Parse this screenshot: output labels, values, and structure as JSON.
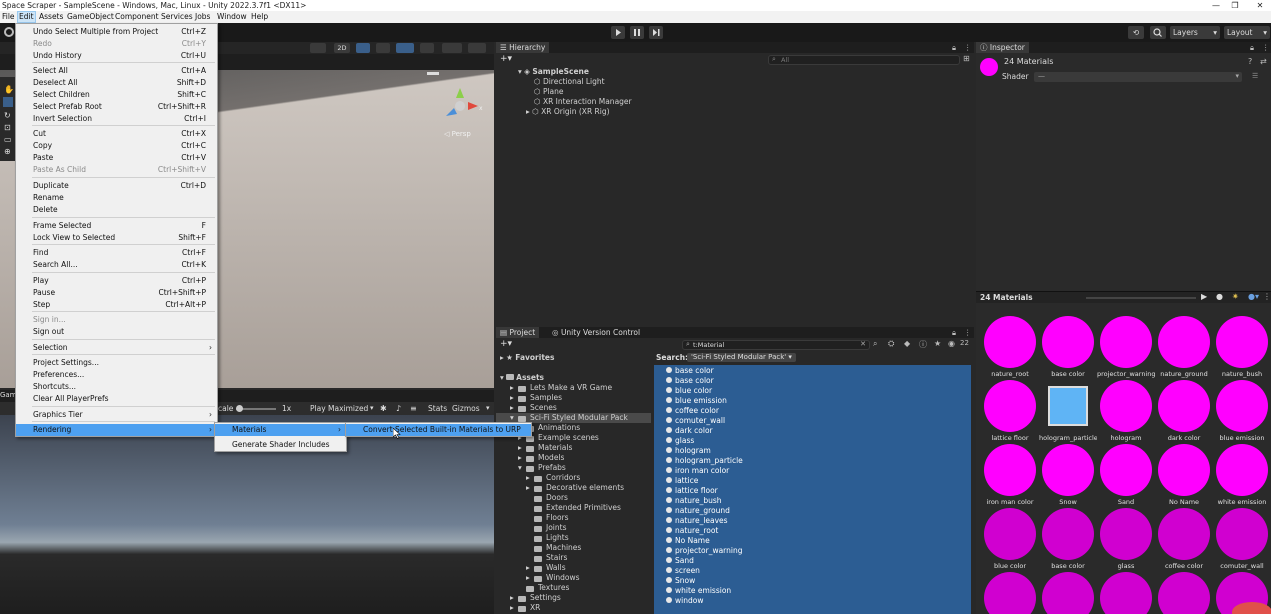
{
  "window": {
    "title": "Space Scraper - SampleScene - Windows, Mac, Linux - Unity 2022.3.7f1 <DX11>",
    "controls": [
      "—",
      "❐",
      "✕"
    ]
  },
  "menubar": {
    "items": [
      "File",
      "Edit",
      "Assets",
      "GameObject",
      "Component",
      "Services",
      "Jobs",
      "Window",
      "Help"
    ]
  },
  "toolbar": {
    "layers": "Layers",
    "layout": "Layout"
  },
  "scene": {
    "mode_2d": "2D",
    "persp": "◁ Persp"
  },
  "game": {
    "scale_label": "cale",
    "scale_value": "1x",
    "play_mode": "Play Maximized",
    "stats": "Stats",
    "gizmos": "Gizmos",
    "tab": "Gam"
  },
  "edit_menu": {
    "items": [
      {
        "label": "Undo Select Multiple from Project",
        "shortcut": "Ctrl+Z"
      },
      {
        "label": "Redo",
        "shortcut": "Ctrl+Y",
        "disabled": true
      },
      {
        "label": "Undo History",
        "shortcut": "Ctrl+U"
      },
      {
        "label": "Select All",
        "shortcut": "Ctrl+A"
      },
      {
        "label": "Deselect All",
        "shortcut": "Shift+D"
      },
      {
        "label": "Select Children",
        "shortcut": "Shift+C"
      },
      {
        "label": "Select Prefab Root",
        "shortcut": "Ctrl+Shift+R"
      },
      {
        "label": "Invert Selection",
        "shortcut": "Ctrl+I"
      },
      {
        "label": "Cut",
        "shortcut": "Ctrl+X"
      },
      {
        "label": "Copy",
        "shortcut": "Ctrl+C"
      },
      {
        "label": "Paste",
        "shortcut": "Ctrl+V"
      },
      {
        "label": "Paste As Child",
        "shortcut": "Ctrl+Shift+V",
        "disabled": true
      },
      {
        "label": "Duplicate",
        "shortcut": "Ctrl+D"
      },
      {
        "label": "Rename",
        "shortcut": ""
      },
      {
        "label": "Delete",
        "shortcut": ""
      },
      {
        "label": "Frame Selected",
        "shortcut": "F"
      },
      {
        "label": "Lock View to Selected",
        "shortcut": "Shift+F"
      },
      {
        "label": "Find",
        "shortcut": "Ctrl+F"
      },
      {
        "label": "Search All...",
        "shortcut": "Ctrl+K"
      },
      {
        "label": "Play",
        "shortcut": "Ctrl+P"
      },
      {
        "label": "Pause",
        "shortcut": "Ctrl+Shift+P"
      },
      {
        "label": "Step",
        "shortcut": "Ctrl+Alt+P"
      },
      {
        "label": "Sign in...",
        "shortcut": "",
        "disabled": true
      },
      {
        "label": "Sign out",
        "shortcut": ""
      },
      {
        "label": "Selection",
        "shortcut": "",
        "submenu": true
      },
      {
        "label": "Project Settings...",
        "shortcut": ""
      },
      {
        "label": "Preferences...",
        "shortcut": ""
      },
      {
        "label": "Shortcuts...",
        "shortcut": ""
      },
      {
        "label": "Clear All PlayerPrefs",
        "shortcut": ""
      },
      {
        "label": "Graphics Tier",
        "shortcut": "",
        "submenu": true
      },
      {
        "label": "Rendering",
        "shortcut": "",
        "submenu": true,
        "highlighted": true
      }
    ]
  },
  "rendering_submenu": {
    "items": [
      "Materials",
      "Generate Shader Includes"
    ]
  },
  "materials_submenu": {
    "items": [
      "Convert Selected Built-in Materials to URP"
    ]
  },
  "hierarchy": {
    "tab": "Hierarchy",
    "search_placeholder": "All",
    "scene": "SampleScene",
    "objects": [
      "Directional Light",
      "Plane",
      "XR Interaction Manager",
      "XR Origin (XR Rig)"
    ]
  },
  "inspector": {
    "tab": "Inspector",
    "title": "24 Materials",
    "shader_label": "Shader",
    "shader_value": "—",
    "preview_title": "24 Materials",
    "accent": "#ff00ff"
  },
  "project": {
    "tabs": [
      "Project",
      "Unity Version Control"
    ],
    "search_value": "t:Material",
    "search_label": "Search:",
    "search_scope": "'Sci-Fi Styled Modular Pack'",
    "count": "22",
    "favorites": "Favorites",
    "assets": "Assets",
    "folders": [
      {
        "name": "Lets Make a VR Game",
        "depth": 1
      },
      {
        "name": "Samples",
        "depth": 1
      },
      {
        "name": "Scenes",
        "depth": 1
      },
      {
        "name": "Sci-Fi Styled Modular Pack",
        "depth": 1,
        "selected": true
      },
      {
        "name": "Animations",
        "depth": 2
      },
      {
        "name": "Example scenes",
        "depth": 2
      },
      {
        "name": "Materials",
        "depth": 2
      },
      {
        "name": "Models",
        "depth": 2
      },
      {
        "name": "Prefabs",
        "depth": 2
      },
      {
        "name": "Corridors",
        "depth": 3
      },
      {
        "name": "Decorative elements",
        "depth": 3
      },
      {
        "name": "Doors",
        "depth": 3
      },
      {
        "name": "Extended Primitives",
        "depth": 3
      },
      {
        "name": "Floors",
        "depth": 3
      },
      {
        "name": "Joints",
        "depth": 3
      },
      {
        "name": "Lights",
        "depth": 3
      },
      {
        "name": "Machines",
        "depth": 3
      },
      {
        "name": "Stairs",
        "depth": 3
      },
      {
        "name": "Walls",
        "depth": 3
      },
      {
        "name": "Windows",
        "depth": 3
      },
      {
        "name": "Textures",
        "depth": 2
      },
      {
        "name": "Settings",
        "depth": 1
      },
      {
        "name": "XR",
        "depth": 1
      }
    ],
    "results": [
      "base color",
      "base color",
      "blue color",
      "blue emission",
      "coffee color",
      "comuter_wall",
      "dark color",
      "glass",
      "hologram",
      "hologram_particle",
      "iron man color",
      "lattice",
      "lattice floor",
      "nature_bush",
      "nature_ground",
      "nature_leaves",
      "nature_root",
      "No Name",
      "projector_warning",
      "Sand",
      "screen",
      "Snow",
      "white emission",
      "window"
    ]
  },
  "preview_grid": [
    "nature_root",
    "base color",
    "projector_warning",
    "nature_ground",
    "nature_bush",
    "lattice floor",
    "hologram_particle",
    "hologram",
    "dark color",
    "blue emission",
    "iron man color",
    "Snow",
    "Sand",
    "No Name",
    "white emission",
    "blue color",
    "base color",
    "glass",
    "coffee color",
    "comuter_wall",
    "",
    "",
    "",
    "",
    ""
  ]
}
